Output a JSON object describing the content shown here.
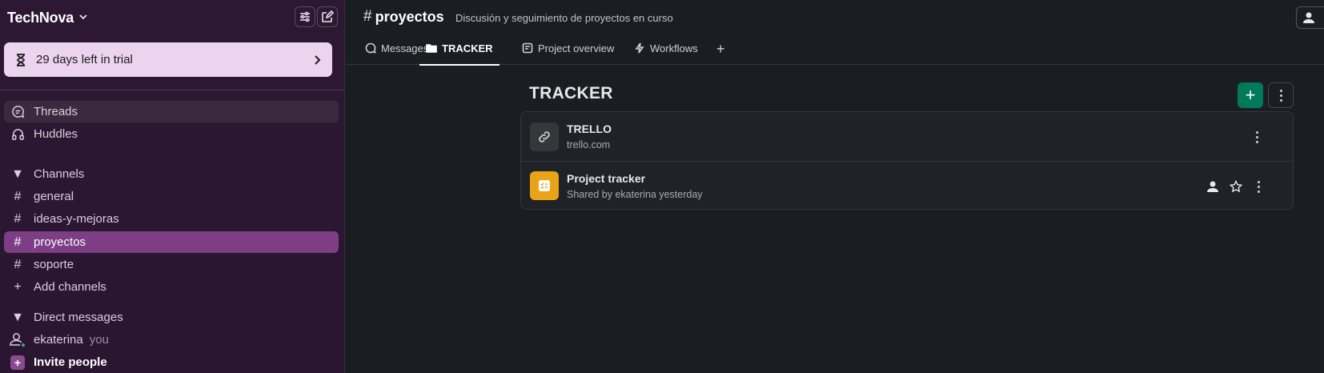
{
  "workspace": {
    "name": "TechNova"
  },
  "trial": {
    "label": "29 days left in trial"
  },
  "sidebar": {
    "nav": [
      {
        "label": "Threads"
      },
      {
        "label": "Huddles"
      }
    ],
    "channels_header": "Channels",
    "channels": [
      {
        "label": "general"
      },
      {
        "label": "ideas-y-mejoras"
      },
      {
        "label": "proyectos",
        "active": true
      },
      {
        "label": "soporte"
      }
    ],
    "add_channels": "Add channels",
    "dm_header": "Direct messages",
    "dm_user": "ekaterina",
    "dm_you": "you",
    "invite": "Invite people"
  },
  "channel": {
    "hash": "#",
    "name": "proyectos",
    "topic": "Discusión y seguimiento de proyectos en curso"
  },
  "tabs": [
    {
      "label": "Messages"
    },
    {
      "label": "TRACKER",
      "active": true
    },
    {
      "label": "Project overview"
    },
    {
      "label": "Workflows"
    }
  ],
  "tracker": {
    "title": "TRACKER",
    "items": [
      {
        "title": "TRELLO",
        "subtitle": "trello.com",
        "icon": "link-icon"
      },
      {
        "title": "Project tracker",
        "subtitle": "Shared by ekaterina yesterday",
        "icon": "list-icon"
      }
    ]
  },
  "colors": {
    "sidebar_bg": "#2a1630",
    "active_channel": "#7d3e86",
    "trial_bg": "#ecd4ee",
    "add_button": "#007a5a",
    "project_icon_bg": "#e8a317"
  }
}
